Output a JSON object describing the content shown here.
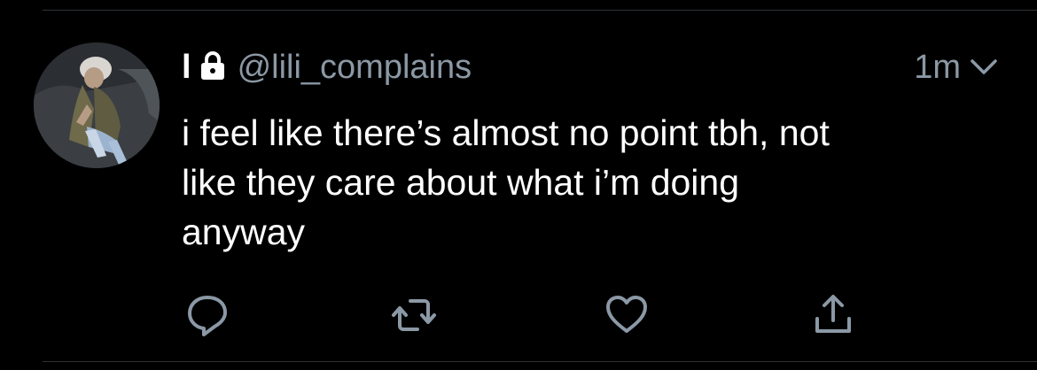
{
  "tweet": {
    "display_name": "l",
    "handle": "@lili_complains",
    "timestamp": "1m",
    "text": "i feel like there’s almost no point tbh, not\nlike they care about what i’m doing\nanyway",
    "account_locked": true
  },
  "icons": {
    "avatar": "avatar",
    "lock": "lock-icon",
    "menu": "chevron-down-icon",
    "reply": "reply-icon",
    "retweet": "retweet-icon",
    "like": "heart-icon",
    "share": "share-icon"
  },
  "colors": {
    "background": "#000000",
    "text_primary": "#ffffff",
    "text_secondary": "#8b98a5",
    "icon": "#8b98a5",
    "divider": "#2f3336"
  }
}
